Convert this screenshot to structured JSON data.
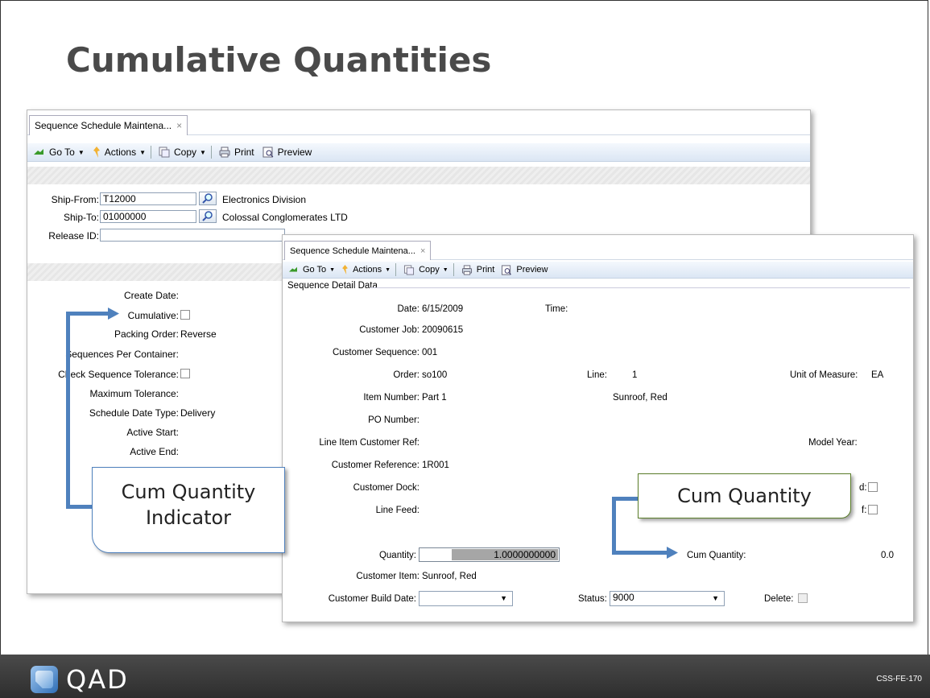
{
  "slide": {
    "title": "Cumulative Quantities",
    "logo_text": "QAD",
    "code": "CSS-FE-170"
  },
  "win1": {
    "tab_title": "Sequence Schedule Maintena...",
    "tab_close": "×",
    "toolbar": {
      "goto": "Go To",
      "actions": "Actions",
      "copy": "Copy",
      "print": "Print",
      "preview": "Preview"
    },
    "header": {
      "ship_from_label": "Ship-From:",
      "ship_from_value": "T12000",
      "ship_from_name": "Electronics Division",
      "ship_to_label": "Ship-To:",
      "ship_to_value": "01000000",
      "ship_to_name": "Colossal Conglomerates LTD",
      "release_id_label": "Release ID:"
    },
    "fields": {
      "create_date": "Create Date:",
      "cumulative": "Cumulative:",
      "packing_order": "Packing Order:",
      "packing_order_value": "Reverse",
      "seq_per_container": "Sequences Per Container:",
      "check_seq_tol": "Check Sequence Tolerance:",
      "max_tol": "Maximum Tolerance:",
      "sched_date_type": "Schedule Date Type:",
      "sched_date_type_value": "Delivery",
      "active_start": "Active Start:",
      "active_end": "Active End:"
    }
  },
  "win2": {
    "tab_title": "Sequence Schedule Maintena...",
    "tab_close": "×",
    "toolbar": {
      "goto": "Go To",
      "actions": "Actions",
      "copy": "Copy",
      "print": "Print",
      "preview": "Preview"
    },
    "section_title": "Sequence Detail Data",
    "fields": {
      "date_label": "Date:",
      "date_value": "6/15/2009",
      "time_label": "Time:",
      "customer_job_label": "Customer Job:",
      "customer_job_value": "20090615",
      "customer_seq_label": "Customer Sequence:",
      "customer_seq_value": "001",
      "order_label": "Order:",
      "order_value": "so100",
      "line_label": "Line:",
      "line_value": "1",
      "uom_label": "Unit of Measure:",
      "uom_value": "EA",
      "item_label": "Item Number:",
      "item_value": "Part 1",
      "item_desc": "Sunroof, Red",
      "po_label": "PO Number:",
      "line_item_ref_label": "Line Item Customer Ref:",
      "model_year_label": "Model Year:",
      "cust_ref_label": "Customer Reference:",
      "cust_ref_value": "1R001",
      "cust_dock_label": "Customer Dock:",
      "line_feed_label": "Line Feed:",
      "partial_d": "d:",
      "partial_f": "f:",
      "quantity_label": "Quantity:",
      "quantity_value": "1.0000000000",
      "cum_qty_label": "Cum Quantity:",
      "cum_qty_value": "0.0",
      "cust_item_label": "Customer Item:",
      "cust_item_value": "Sunroof, Red",
      "build_date_label": "Customer Build Date:",
      "status_label": "Status:",
      "status_value": "9000",
      "delete_label": "Delete:"
    }
  },
  "callouts": {
    "cum_qty_indicator": [
      "Cum Quantity",
      "Indicator"
    ],
    "cum_qty": "Cum Quantity"
  },
  "colors": {
    "arrow": "#4f81bd",
    "callout_green": "#5a7d2a",
    "callout_blue": "#4f81bd"
  }
}
